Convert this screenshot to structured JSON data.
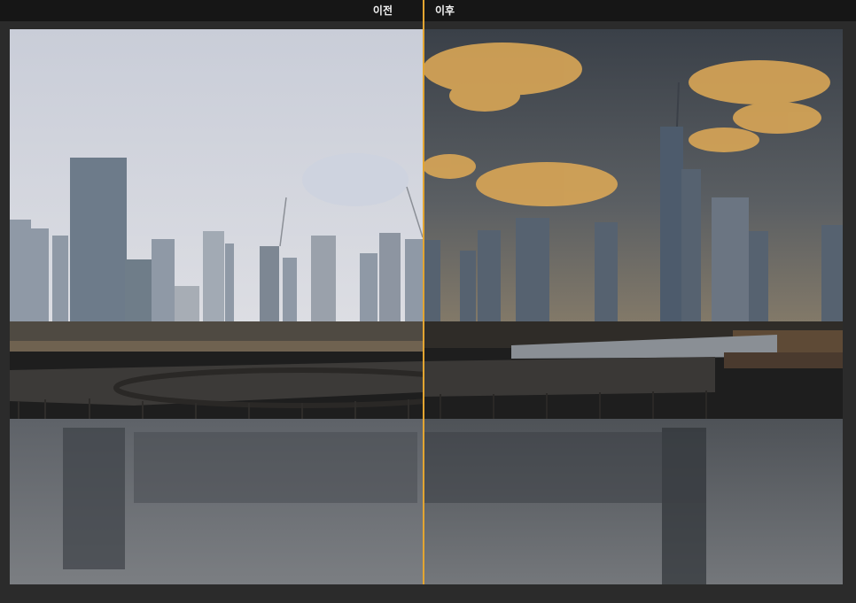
{
  "compare": {
    "before_label": "이전",
    "after_label": "이후"
  },
  "colors": {
    "divider": "#e3a531",
    "topbar": "#161616",
    "background": "#2b2b2b"
  }
}
